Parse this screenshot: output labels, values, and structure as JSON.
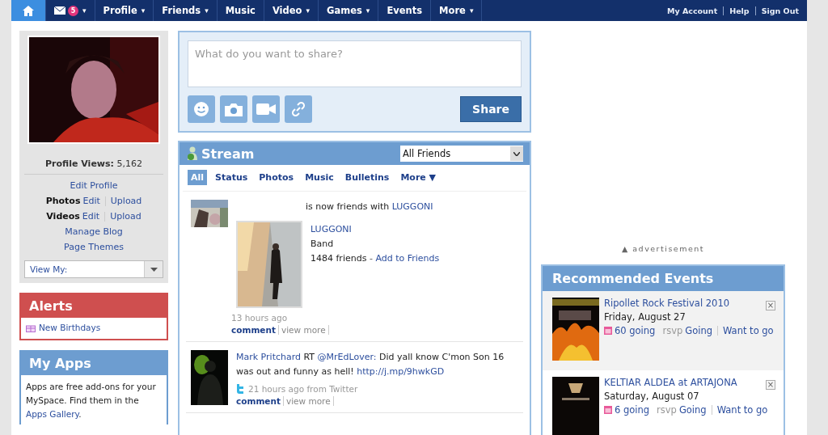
{
  "nav": {
    "items": [
      {
        "kind": "home",
        "selected": true
      },
      {
        "kind": "mail",
        "badge": "5",
        "caret": "▾",
        "selected": false
      },
      {
        "kind": "text",
        "label": "Profile",
        "caret": "▾",
        "selected": false
      },
      {
        "kind": "text",
        "label": "Friends",
        "caret": "▾",
        "selected": false
      },
      {
        "kind": "text",
        "label": "Music",
        "selected": false
      },
      {
        "kind": "text",
        "label": "Video",
        "caret": "▾",
        "selected": false
      },
      {
        "kind": "text",
        "label": "Games",
        "caret": "▾",
        "selected": false
      },
      {
        "kind": "text",
        "label": "Events",
        "selected": false
      },
      {
        "kind": "text",
        "label": "More",
        "caret": "▾",
        "selected": false
      }
    ],
    "account": [
      "My Account",
      "Help",
      "Sign Out"
    ]
  },
  "profile": {
    "views_label": "Profile Views:",
    "views": "5,162",
    "edit": "Edit Profile",
    "media": [
      {
        "label": "Photos",
        "links": [
          "Edit",
          "Upload"
        ]
      },
      {
        "label": "Videos",
        "links": [
          "Edit",
          "Upload"
        ]
      }
    ],
    "links": [
      "Manage Blog",
      "Page Themes"
    ],
    "view_my": {
      "placeholder": "View My:"
    }
  },
  "alerts": {
    "title": "Alerts",
    "items": [
      "New Birthdays"
    ]
  },
  "apps": {
    "title": "My Apps",
    "text_before": "Apps are free add-ons for your MySpace. Find them in the ",
    "link": "Apps Gallery",
    "text_after": "."
  },
  "share": {
    "placeholder": "What do you want to share?",
    "button": "Share"
  },
  "stream": {
    "title": "Stream",
    "filter": "All Friends",
    "tabs": [
      {
        "label": "All",
        "selected": true
      },
      {
        "label": "Status",
        "selected": false
      },
      {
        "label": "Photos",
        "selected": false
      },
      {
        "label": "Music",
        "selected": false
      },
      {
        "label": "Bulletins",
        "selected": false
      },
      {
        "label": "More ▼",
        "selected": false
      }
    ],
    "posts": [
      {
        "kind": "friend",
        "text": "is now friends with ",
        "link": "LUGGONI",
        "card": {
          "name": "LUGGONI",
          "type": "Band",
          "friends": "1484 friends",
          "sep": " - ",
          "add": "Add to Friends"
        },
        "time": "13 hours ago",
        "actions": [
          "comment",
          "view more"
        ]
      },
      {
        "kind": "status",
        "author": "Mark Pritchard",
        "text1": " RT ",
        "mention": "@MrEdLover:",
        "text2": " Did yall know C'mon Son 16 was out and funny as hell! ",
        "url": "http://j.mp/9hwkGD",
        "time": "21 hours ago from Twitter",
        "actions": [
          "comment",
          "view more"
        ]
      }
    ]
  },
  "advertisement": "▲ advertisement",
  "events": {
    "title": "Recommended Events",
    "items": [
      {
        "name": "Ripollet Rock Festival 2010",
        "date": "Friday, August 27",
        "going": "60 going",
        "rsvp": "rsvp",
        "options": [
          "Going",
          "Want to go"
        ],
        "close": "×"
      },
      {
        "name": "KELTIAR ALDEA at ARTAJONA",
        "date": "Saturday, August 07",
        "going": "6 going",
        "rsvp": "rsvp",
        "options": [
          "Going",
          "Want to go"
        ],
        "close": "×"
      }
    ]
  }
}
